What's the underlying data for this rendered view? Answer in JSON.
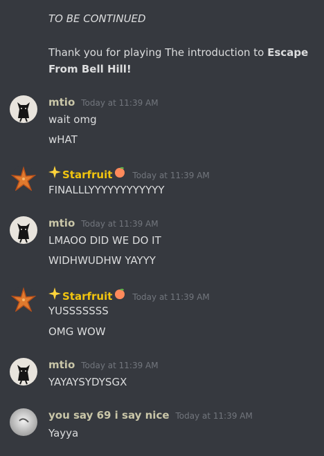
{
  "colors": {
    "background": "#36393f",
    "text": "#dcddde",
    "timestamp": "#72767d",
    "mtio_name": "#c9c6a8",
    "starfruit_name": "#f1c40f",
    "yousay_name": "#c9c6a8"
  },
  "intro": {
    "continued": "TO BE CONTINUED",
    "thanks_prefix": "Thank you for playing The introduction to ",
    "thanks_bold_1": "Escape",
    "thanks_bold_2": "From Bell Hill!"
  },
  "messages": [
    {
      "author": "mtio",
      "timestamp": "Today at 11:39 AM",
      "avatar_icon": "black-cat-avatar",
      "lines": [
        "wait omg",
        "wHAT"
      ]
    },
    {
      "author": "Starfruit",
      "author_prefix_icon": "glowing-star-emoji",
      "author_suffix_icon": "peach-emoji",
      "timestamp": "Today at 11:39 AM",
      "avatar_icon": "starfish-avatar",
      "lines": [
        "FINALLLYYYYYYYYYYYY"
      ]
    },
    {
      "author": "mtio",
      "timestamp": "Today at 11:39 AM",
      "avatar_icon": "black-cat-avatar",
      "lines": [
        "LMAOO DID WE DO IT",
        "WIDHWUDHW YAYYY"
      ]
    },
    {
      "author": "Starfruit",
      "author_prefix_icon": "glowing-star-emoji",
      "author_suffix_icon": "peach-emoji",
      "timestamp": "Today at 11:39 AM",
      "avatar_icon": "starfish-avatar",
      "lines": [
        "YUSSSSSSS",
        "OMG WOW"
      ]
    },
    {
      "author": "mtio",
      "timestamp": "Today at 11:39 AM",
      "avatar_icon": "black-cat-avatar",
      "lines": [
        "YAYAYSYDYSGX"
      ]
    },
    {
      "author": "you say 69 i say nice",
      "timestamp": "Today at 11:39 AM",
      "avatar_icon": "gray-photo-avatar",
      "lines": [
        "Yayya"
      ]
    }
  ]
}
